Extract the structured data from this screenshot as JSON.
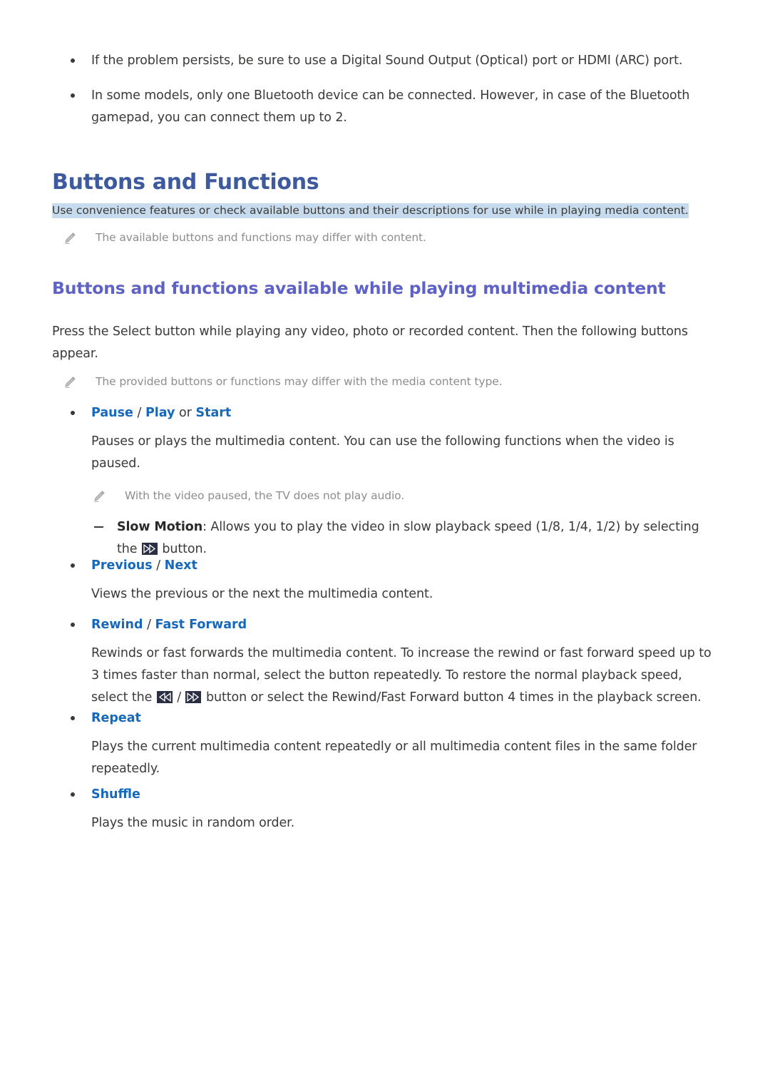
{
  "document": {
    "title": "Buttons and Functions",
    "summary": "Use convenience features or check available buttons and their descriptions for use while in playing media content.",
    "top_note": "The available buttons and functions may differ  with content.",
    "subheading": "Buttons and functions available while playing multimedia content",
    "intro_paragraph": "Press the Select button while playing any video, photo or recorded content. Then the following buttons appear.",
    "intro_note": "The provided buttons or functions may differ with the media content type."
  },
  "intro_bullets": [
    "If the problem persists, be sure to use a Digital Sound Output (Optical) port or HDMI (ARC) port.",
    "In some models, only one Bluetooth device can be connected. However, in case of the Bluetooth gamepad, you can connect them up to 2."
  ],
  "features": {
    "pause": {
      "kw1": "Pause",
      "sep1": " / ",
      "kw2": "Play",
      "sep2": " or ",
      "kw3": "Start",
      "body": "Pauses or plays the multimedia content. You can use the following functions when the video is paused.",
      "note": "With the video paused, the TV does not play audio.",
      "slow_motion_label": "Slow Motion",
      "slow_motion_text_1": ": Allows you to play the video in slow playback speed (1/8, 1/4, 1/2) by selecting the ",
      "slow_motion_text_2": " button."
    },
    "previous": {
      "kw1": "Previous",
      "sep1": " / ",
      "kw2": "Next",
      "body": "Views the previous or the next the multimedia content."
    },
    "rewind": {
      "kw1": "Rewind",
      "sep1": " / ",
      "kw2": "Fast Forward",
      "body_1": "Rewinds or fast forwards the multimedia content. To increase the rewind or fast forward speed up to 3 times faster than normal, select the button repeatedly. To restore the normal playback speed, select the ",
      "body_2": " / ",
      "body_3": " button or select the Rewind/Fast Forward button 4 times in the playback screen."
    },
    "repeat": {
      "kw1": "Repeat",
      "body": "Plays the current multimedia content repeatedly or all multimedia content files in the same folder repeatedly."
    },
    "shuffle": {
      "kw1": "Shuffle",
      "body": "Plays the music in random order."
    }
  },
  "colors": {
    "h1": "#3d5a9e",
    "h2": "#5e62c6",
    "keyword": "#1668bd",
    "body": "#3c3a38",
    "note": "#8d8d8d",
    "highlight": "#c6dbee",
    "media_key_bg": "#2b2f43"
  },
  "icons": {
    "note_icon": "pencil-icon",
    "fast_forward": "fast-forward-icon",
    "rewind": "rewind-icon"
  }
}
